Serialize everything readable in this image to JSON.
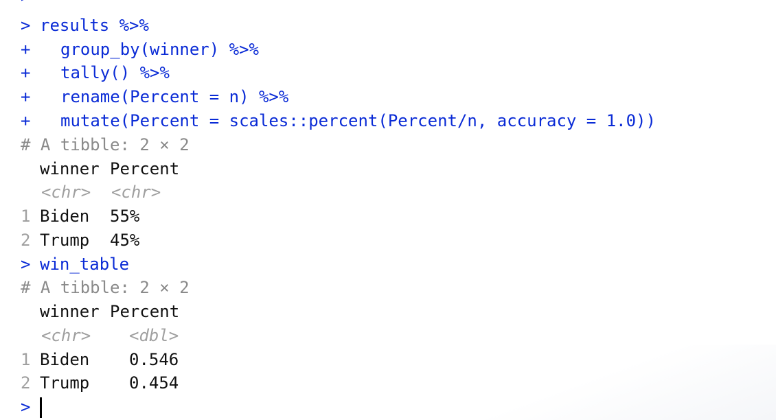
{
  "console": {
    "prompt_symbol": ">",
    "continuation_symbol": "+",
    "commands": {
      "pipeline": [
        "results %>%",
        "group_by(winner) %>%",
        "tally() %>%",
        "rename(Percent = n) %>%",
        "mutate(Percent = scales::percent(Percent/n, accuracy = 1.0))"
      ],
      "second": "win_table"
    },
    "output1": {
      "header": "# A tibble: 2 × 2",
      "columns": [
        "winner",
        "Percent"
      ],
      "types": [
        "<chr>",
        "<chr>"
      ],
      "rows": [
        {
          "index": "1",
          "winner": "Biden",
          "percent": "55%"
        },
        {
          "index": "2",
          "winner": "Trump",
          "percent": "45%"
        }
      ]
    },
    "output2": {
      "header": "# A tibble: 2 × 2",
      "columns": [
        "winner",
        "Percent"
      ],
      "types": [
        "<chr>",
        "<dbl>"
      ],
      "rows": [
        {
          "index": "1",
          "winner": "Biden",
          "percent": "0.546"
        },
        {
          "index": "2",
          "winner": "Trump",
          "percent": "0.454"
        }
      ]
    }
  }
}
